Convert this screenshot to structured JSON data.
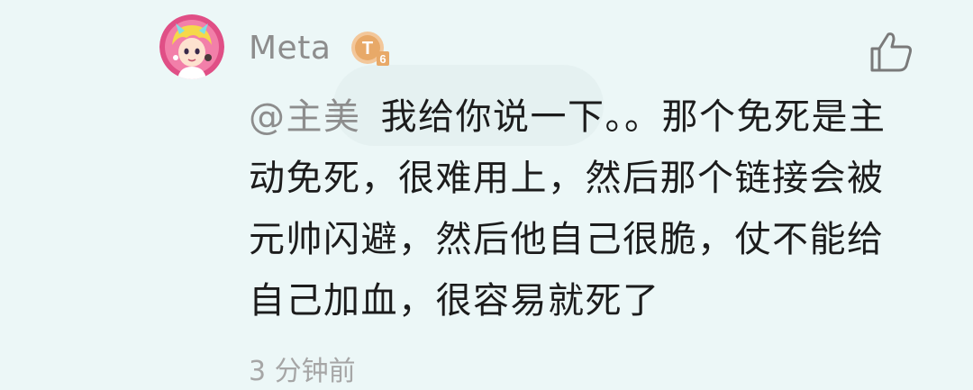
{
  "comment": {
    "username": "Meta",
    "level_badge": {
      "letter": "T",
      "level": "6",
      "color": "#e8a968"
    },
    "mention": "@主美",
    "text": "我给你说一下。。那个免死是主动免死，很难用上，然后那个链接会被元帅闪避，然后他自己很脆，仗不能给自己加血，很容易就死了",
    "timestamp": "3 分钟前",
    "like_icon": "thumbs-up-icon"
  },
  "colors": {
    "background": "#ecf7f7",
    "username": "#8d8d8d",
    "body_text": "#1c1c1c",
    "mention": "#8d8d8d",
    "avatar_bg": "#e04f86"
  }
}
